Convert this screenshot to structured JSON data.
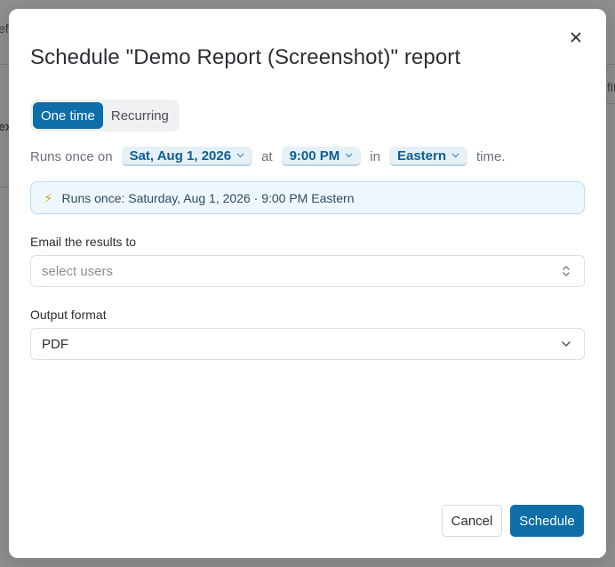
{
  "background": {
    "fragments": [
      "efi",
      "fit",
      "ex"
    ]
  },
  "modal": {
    "title": "Schedule \"Demo Report (Screenshot)\" report",
    "close_icon": "close-icon",
    "mode_tabs": [
      {
        "label": "One time",
        "active": true
      },
      {
        "label": "Recurring",
        "active": false
      }
    ],
    "runs": {
      "prefix": "Runs once on",
      "date": "Sat, Aug 1, 2026",
      "at": "at",
      "time": "9:00 PM",
      "in": "in",
      "timezone": "Eastern",
      "suffix": "time."
    },
    "banner": {
      "icon": "lightning-icon",
      "text": "Runs once: Saturday, Aug 1, 2026 · 9:00 PM Eastern"
    },
    "email": {
      "label": "Email the results to",
      "placeholder": "select users",
      "value": ""
    },
    "output": {
      "label": "Output format",
      "value": "PDF"
    },
    "buttons": {
      "cancel": "Cancel",
      "schedule": "Schedule"
    },
    "colors": {
      "accent": "#0d6ea8",
      "banner_bg": "#eef7fd",
      "banner_border": "#b9dcf1",
      "bolt": "#e8a21a"
    }
  }
}
